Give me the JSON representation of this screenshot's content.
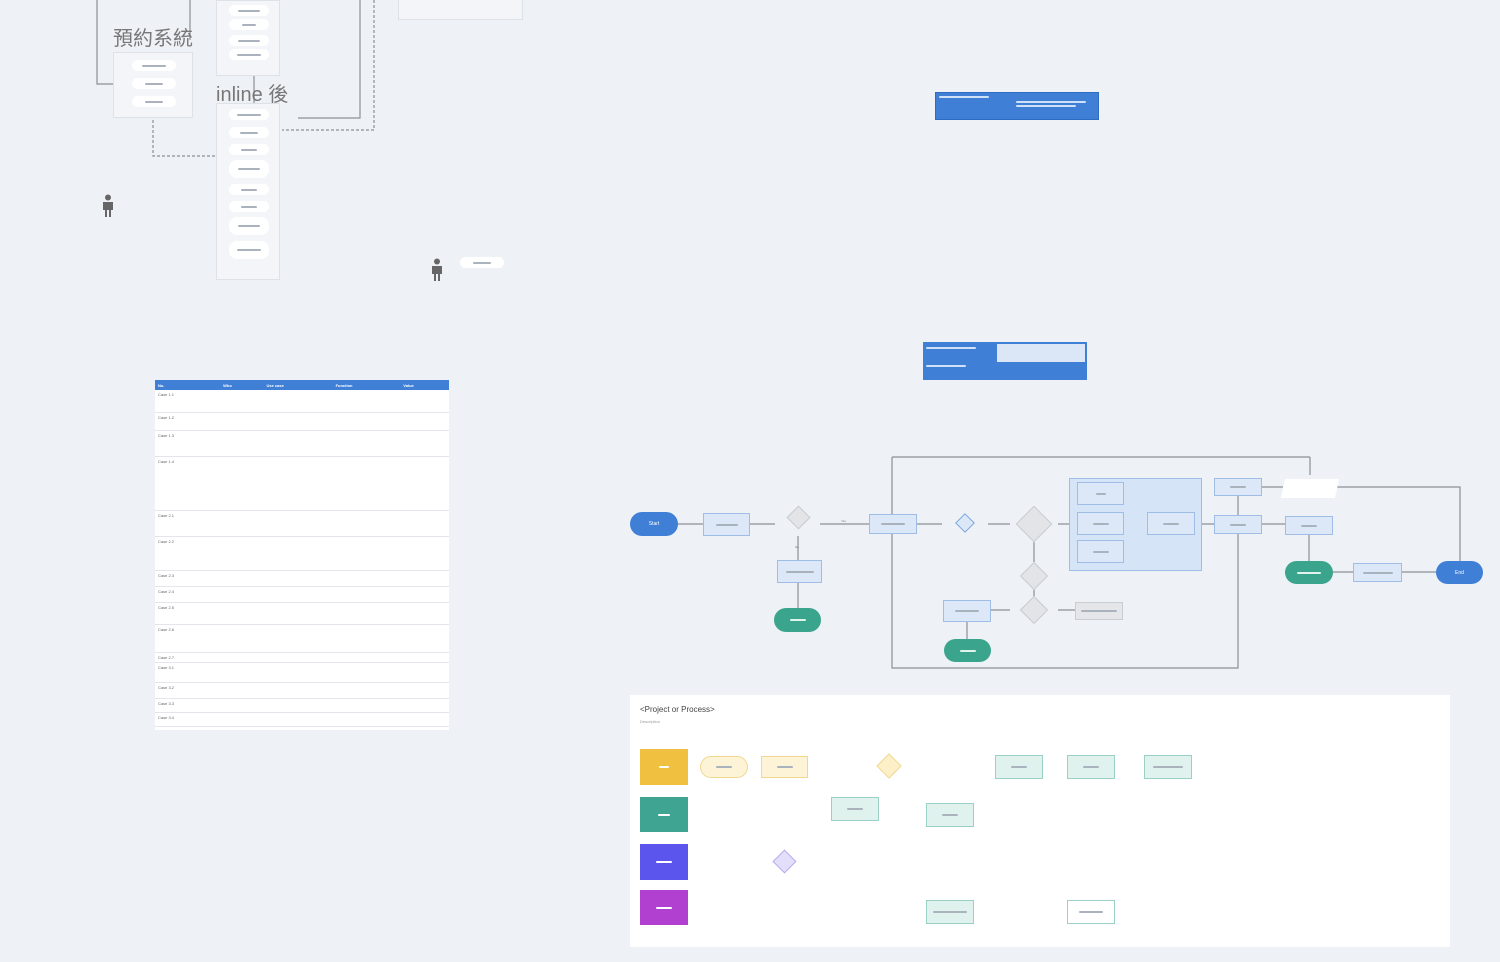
{
  "canvas": {
    "background": "#eef2f6"
  },
  "top_left": {
    "title_booking": "預約系統",
    "title_inline": "inline 後"
  },
  "table": {
    "headers": [
      "No.",
      "Who",
      "Use case",
      "Function",
      "Value"
    ],
    "rows": [
      "Case 1.1",
      "Case 1.2",
      "Case 1.3",
      "Case 1.4",
      "Case 2.1",
      "Case 2.2",
      "Case 2.3",
      "Case 2.4",
      "Case 2.5",
      "Case 2.6",
      "Case 2.7",
      "Case 3.1",
      "Case 3.2",
      "Case 3.3",
      "Case 3.4"
    ],
    "header_color": "#3f7fd6"
  },
  "flowchart": {
    "start": "Start",
    "end": "End",
    "yes": "Yes",
    "no": "No",
    "colors": {
      "terminal": "#3f7fd6",
      "end_green": "#3aa58c",
      "box": "#dce8f8"
    }
  },
  "swimlane": {
    "title": "<Project or Process>",
    "description": "Description",
    "lane_colors": [
      "#f0c040",
      "#3fa592",
      "#5b55ee",
      "#b13fd0"
    ]
  }
}
